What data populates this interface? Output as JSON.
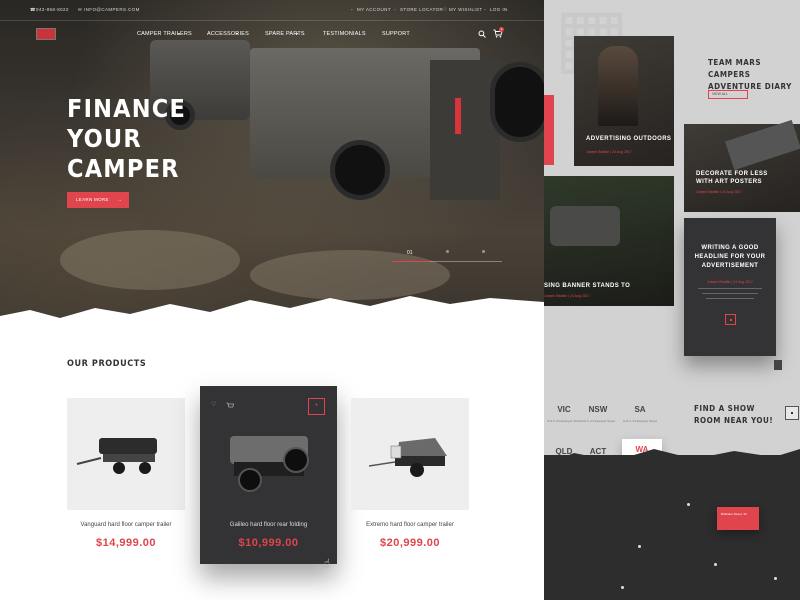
{
  "topbar": {
    "phone": "043-858-8022",
    "email": "INFO@CAMPERS.COM",
    "my_account": "MY ACCOUNT",
    "store_locator": "STORE LOCATOR",
    "wishlist": "MY WISHLIST",
    "login": "LOG IN"
  },
  "nav": {
    "items": [
      "CAMPER TRAILERS",
      "ACCESSORIES",
      "SPARE PARTS",
      "TESTIMONIALS",
      "SUPPORT"
    ],
    "cart_count": "2"
  },
  "hero": {
    "title_lines": [
      "FINANCE",
      "YOUR",
      "CAMPER"
    ],
    "button": "LEARN MORE",
    "button_arrow": "→",
    "slide_current": "01"
  },
  "products": {
    "title": "OUR PRODUCTS",
    "items": [
      {
        "name": "Vanguard hard floor camper trailer",
        "price": "$14,999.00"
      },
      {
        "name": "Galileo hard floor rear folding",
        "price": "$10,999.00"
      },
      {
        "name": "Extremo hard floor camper trailer",
        "price": "$20,999.00"
      }
    ]
  },
  "blog": {
    "title_lines": [
      "TEAM MARS CAMPERS",
      "ADVENTURE DIARY"
    ],
    "view_all": "VIEW ALL",
    "posts": [
      {
        "title": "ADVERTISING OUTDOORS",
        "date": "Joseph Beattie | 24 Aug 2017"
      },
      {
        "title_lines": [
          "DECORATE FOR LESS",
          "WITH ART POSTERS"
        ],
        "date": "Joseph Beattie | 24 Aug 2017"
      },
      {
        "title": "SING BANNER STANDS TO",
        "date": "Joseph Beattie | 24 Aug 2017"
      },
      {
        "title_lines": [
          "WRITING A GOOD",
          "HEADLINE FOR YOUR",
          "ADVERTISEMENT"
        ],
        "date": "Joseph Beattie | 24 Aug 2017"
      }
    ]
  },
  "showroom": {
    "title_lines": [
      "FIND A SHOW",
      "ROOM NEAR YOU!"
    ],
    "states": [
      "VIC",
      "NSW",
      "SA",
      "QLD",
      "ACT",
      "WA"
    ],
    "active_state": "WA",
    "addr": "Unit 6, 24 Example Street",
    "map_popup": "Brisbane Street, 33"
  },
  "colors": {
    "accent": "#e0444c",
    "dark": "#333335"
  }
}
